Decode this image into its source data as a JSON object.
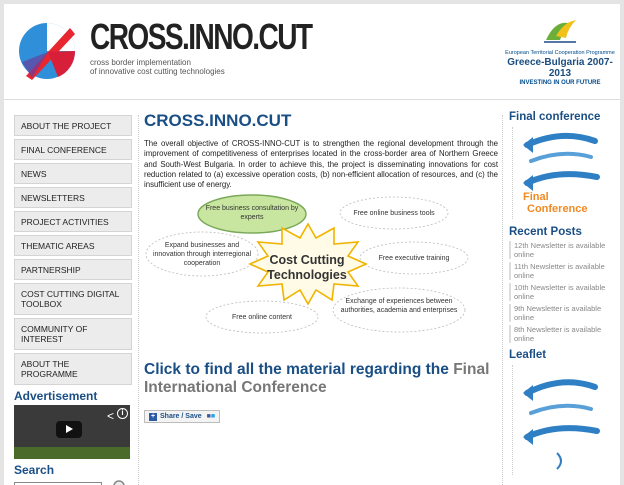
{
  "header": {
    "logo_title": "CROSS.INNO.CUT",
    "logo_sub_1": "cross border implementation",
    "logo_sub_2": "of innovative cost cutting technologies",
    "programme_1": "European Territorial Cooperation Programme",
    "programme_2": "Greece-Bulgaria 2007-2013",
    "programme_3": "INVESTING IN OUR FUTURE"
  },
  "nav": [
    "ABOUT THE PROJECT",
    "FINAL CONFERENCE",
    "NEWS",
    "NEWSLETTERS",
    "PROJECT ACTIVITIES",
    "THEMATIC AREAS",
    "PARTNERSHIP",
    "COST CUTTING DIGITAL TOOLBOX",
    "COMMUNITY OF INTEREST",
    "ABOUT THE PROGRAMME"
  ],
  "sidebar": {
    "advertisement": "Advertisement",
    "search": "Search"
  },
  "main": {
    "title": "CROSS.INNO.CUT",
    "intro": "The overall objective of CROSS-INNO-CUT is to strengthen the regional development through the improvement of competitiveness of enterprises located in the cross-border area of Northern Greece and South-West Bulgaria. In order to achieve this, the project is disseminating innovations for cost reduction related to (a) excessive operation costs, (b) non-efficient allocation of resources, and (c) the insufficient use of energy.",
    "diagram": {
      "center": "Cost Cutting Technologies",
      "b1": "Free business consultation by experts",
      "b2": "Free online business tools",
      "b3": "Expand businesses and innovation through interregional cooperation",
      "b4": "Free executive training",
      "b5": "Free online content",
      "b6": "Exchange of experiences between authorities, academia and enterprises"
    },
    "cta_part1": "Click to find all the material regarding the ",
    "cta_part2": "Final International Conference",
    "share_label": "Share / Save"
  },
  "right": {
    "final_conference": "Final conference",
    "final_img_text_1": "Final",
    "final_img_text_2": "Conference",
    "recent_posts": "Recent Posts",
    "posts": [
      "12th Newsletter is available online",
      "11th Newsletter is available online",
      "10th Newsletter is available online",
      "9th Newsletter is available online",
      "8th Newsletter is available online"
    ],
    "leaflet": "Leaflet"
  },
  "colors": {
    "accent": "#1a4f86",
    "logo_red": "#e8262f",
    "logo_blue": "#2f7fc5",
    "bubble_green": "#c8e6a0"
  }
}
